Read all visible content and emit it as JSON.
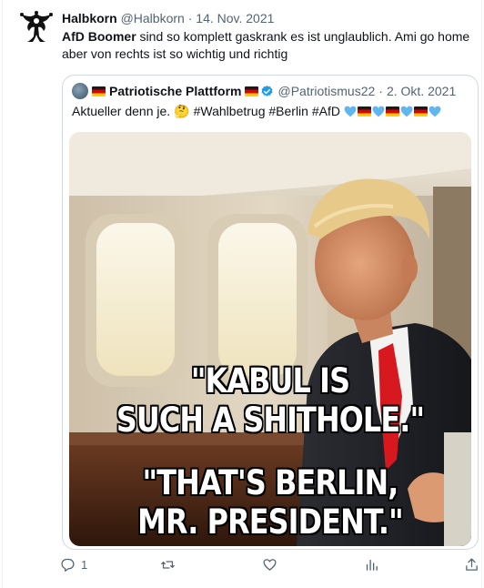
{
  "tweet": {
    "author_name": "Halbkorn",
    "handle": "@Halbkorn",
    "separator": "·",
    "date": "14. Nov. 2021",
    "text_bold": "AfD Boomer",
    "text_rest": " sind so komplett gaskrank es ist unglaublich. Ami go home aber von rechts ist so wichtig und richtig",
    "avatar_icon": "jester-icon"
  },
  "quote": {
    "author_name": "Patriotische Plattform",
    "handle": "@Patriotismus22",
    "separator": "·",
    "date": "2. Okt. 2021",
    "text_prefix": "Aktueller denn je.",
    "emoji": "🤔",
    "hashtags": "#Wahlbetrug #Berlin #AfD",
    "verified_color": "#1d9bf0",
    "heart_color": "#5fb6f0",
    "image": {
      "caption_top_line1": "\"KABUL IS",
      "caption_top_line2": "SUCH A SHITHOLE.\"",
      "caption_bottom_line1": "\"THAT'S BERLIN,",
      "caption_bottom_line2": "MR. PRESIDENT.\""
    }
  },
  "actions": {
    "reply_count": "1",
    "reply_icon": "reply-icon",
    "retweet_icon": "retweet-icon",
    "like_icon": "heart-icon",
    "views_icon": "views-icon",
    "share_icon": "share-icon"
  }
}
